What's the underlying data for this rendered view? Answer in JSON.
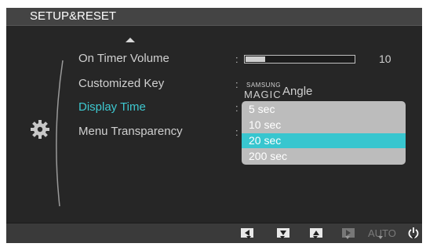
{
  "header": {
    "title": "SETUP&RESET"
  },
  "menu": {
    "items": [
      {
        "label": "On Timer  Volume",
        "active": false
      },
      {
        "label": "Customized Key",
        "active": false
      },
      {
        "label": "Display Time",
        "active": true
      },
      {
        "label": "Menu Transparency",
        "active": false
      }
    ]
  },
  "values": {
    "colon": ":",
    "volume_level": 10,
    "volume_value": "10",
    "volume_max": 100,
    "samsung_small": "SAMSUNG",
    "magic": "MAGIC",
    "angle": "Angle"
  },
  "dropdown": {
    "options": [
      "5 sec",
      "10 sec",
      "20 sec",
      "200 sec"
    ],
    "selected": "20 sec"
  },
  "bottom": {
    "auto_label": "AUTO"
  },
  "colors": {
    "accent": "#3ec8d0",
    "selected_bg": "#38c6cf",
    "dropdown_bg": "#bcbcbc",
    "panel_bg": "#262626"
  },
  "icons": [
    "up-arrow-icon",
    "gear-icon",
    "left-button-icon",
    "down-button-icon",
    "up-button-icon",
    "right-button-icon",
    "power-icon"
  ]
}
